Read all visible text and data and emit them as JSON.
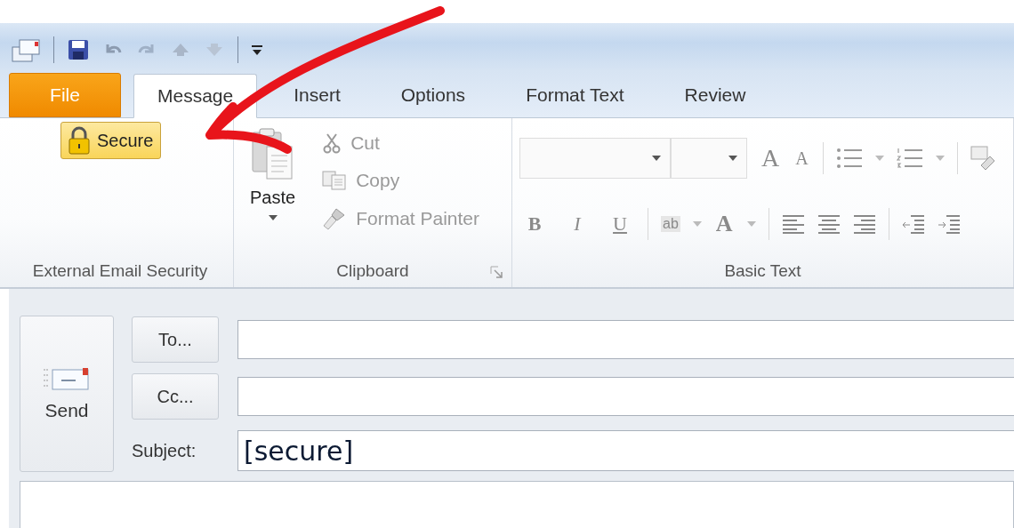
{
  "tabs": [
    {
      "label": "File",
      "kind": "file",
      "selected": false
    },
    {
      "label": "Message",
      "kind": "tab",
      "selected": true
    },
    {
      "label": "Insert",
      "kind": "tab",
      "selected": false
    },
    {
      "label": "Options",
      "kind": "tab",
      "selected": false
    },
    {
      "label": "Format Text",
      "kind": "tab",
      "selected": false
    },
    {
      "label": "Review",
      "kind": "tab",
      "selected": false
    }
  ],
  "ribbon": {
    "groups": [
      {
        "kind": "security",
        "label": "External Email Security",
        "button": "Secure"
      },
      {
        "kind": "clipboard",
        "label": "Clipboard",
        "paste": "Paste",
        "items": [
          {
            "label": "Cut",
            "kind": "cut",
            "disabled": true
          },
          {
            "label": "Copy",
            "kind": "copy",
            "disabled": true
          },
          {
            "label": "Format Painter",
            "kind": "painter",
            "disabled": true
          }
        ]
      },
      {
        "kind": "basic_text",
        "label": "Basic Text",
        "grow": "A",
        "shrink": "A",
        "format": [
          {
            "glyph": "B",
            "kind": "bold"
          },
          {
            "glyph": "I",
            "kind": "italic"
          },
          {
            "glyph": "U",
            "kind": "underline"
          }
        ],
        "highlight": "ab",
        "font_color": "A"
      }
    ]
  },
  "compose": {
    "send": "Send",
    "to": "To...",
    "cc": "Cc...",
    "subject_label": "Subject:",
    "subject": "[secure]"
  }
}
